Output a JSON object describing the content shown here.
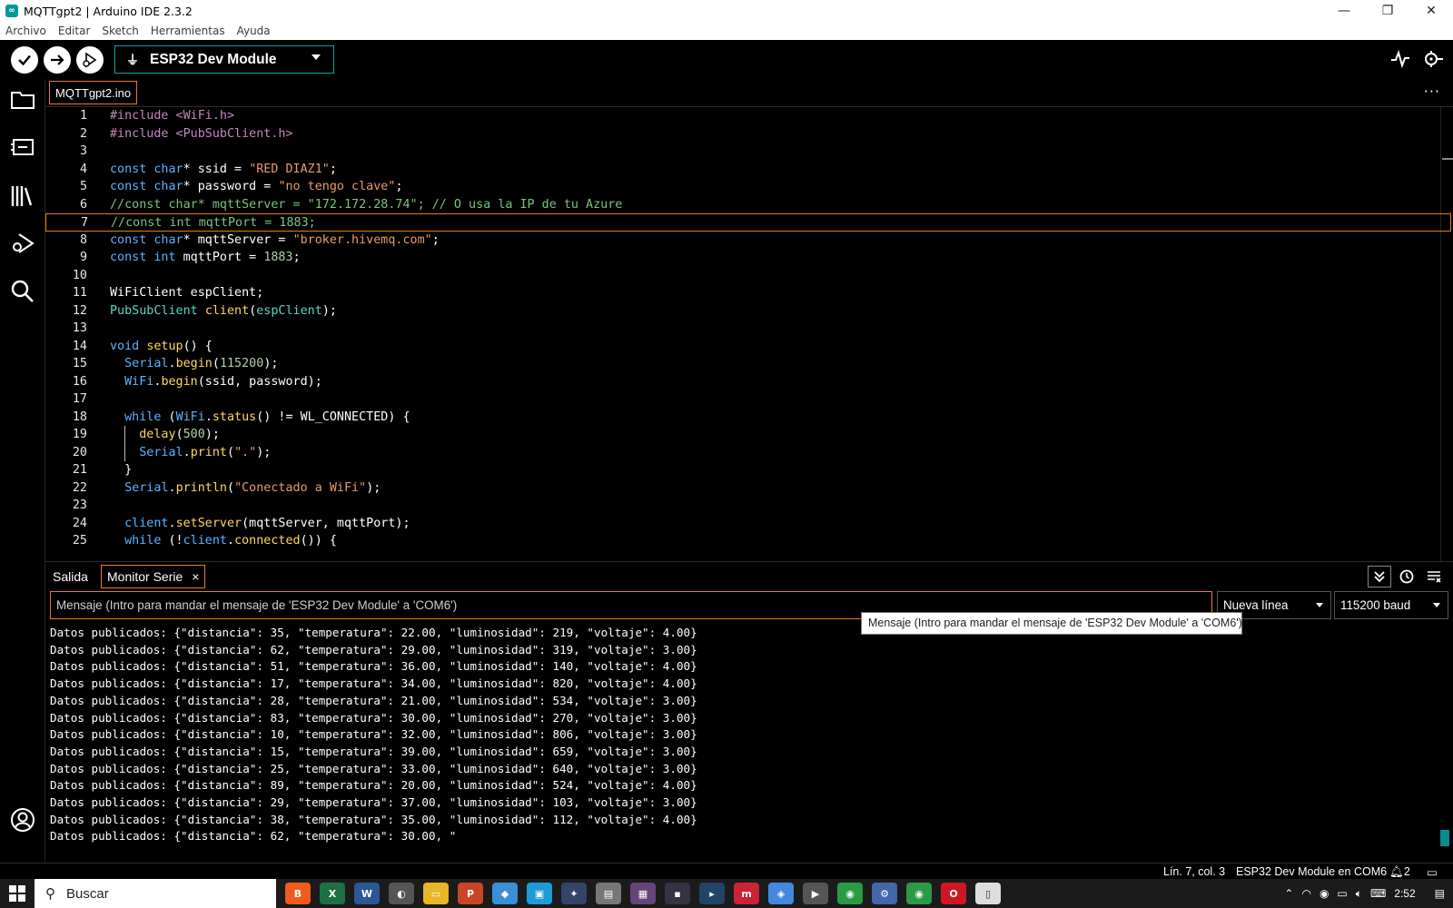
{
  "window": {
    "title": "MQTTgpt2 | Arduino IDE 2.3.2",
    "minimize": "—",
    "restore": "❐",
    "close": "✕"
  },
  "menu": [
    "Archivo",
    "Editar",
    "Sketch",
    "Herramientas",
    "Ayuda"
  ],
  "toolbar": {
    "board": "ESP32 Dev Module"
  },
  "editor": {
    "file_tab": "MQTTgpt2.ino",
    "more": "···",
    "current_line": 7,
    "lines": [
      {
        "n": "1",
        "html": "<span class=\"pp\">#include &lt;WiFi.h&gt;</span>"
      },
      {
        "n": "2",
        "html": "<span class=\"pp\">#include &lt;PubSubClient.h&gt;</span>"
      },
      {
        "n": "3",
        "html": ""
      },
      {
        "n": "4",
        "html": "<span class=\"kw\">const</span> <span class=\"ty\">char</span>* ssid = <span class=\"str\">\"RED DIAZ1\"</span>;"
      },
      {
        "n": "5",
        "html": "<span class=\"kw\">const</span> <span class=\"ty\">char</span>* password = <span class=\"str\">\"no tengo clave\"</span>;"
      },
      {
        "n": "6",
        "html": "<span class=\"cm\">//const char* mqttServer = \"172.172.28.74\"; // O usa la IP de tu Azure</span>"
      },
      {
        "n": "7",
        "html": "<span class=\"cm\">//const int mqttPort = 1883;</span>"
      },
      {
        "n": "8",
        "html": "<span class=\"kw\">const</span> <span class=\"ty\">char</span>* mqttServer = <span class=\"str\">\"broker.hivemq.com\"</span>;"
      },
      {
        "n": "9",
        "html": "<span class=\"kw\">const</span> <span class=\"ty\">int</span> mqttPort = <span class=\"num\">1883</span>;"
      },
      {
        "n": "10",
        "html": ""
      },
      {
        "n": "11",
        "html": "WiFiClient espClient;"
      },
      {
        "n": "12",
        "html": "<span class=\"cls\">PubSubClient</span> <span class=\"fn\">client</span>(<span class=\"cls\">espClient</span>);"
      },
      {
        "n": "13",
        "html": ""
      },
      {
        "n": "14",
        "html": "<span class=\"kw\">void</span> <span class=\"fn\">setup</span>() {"
      },
      {
        "n": "15",
        "html": "  <span class=\"obj\">Serial</span>.<span class=\"fn\">begin</span>(<span class=\"num\">115200</span>);"
      },
      {
        "n": "16",
        "html": "  <span class=\"obj\">WiFi</span>.<span class=\"fn\">begin</span>(ssid, password);"
      },
      {
        "n": "17",
        "html": ""
      },
      {
        "n": "18",
        "html": "  <span class=\"kw\">while</span> (<span class=\"obj\">WiFi</span>.<span class=\"fn\">status</span>() != WL_CONNECTED) {"
      },
      {
        "n": "19",
        "html": "    <span class=\"fn\">delay</span>(<span class=\"num\">500</span>);"
      },
      {
        "n": "20",
        "html": "    <span class=\"obj\">Serial</span>.<span class=\"fn\">print</span>(<span class=\"str\">\".\"</span>);"
      },
      {
        "n": "21",
        "html": "  }"
      },
      {
        "n": "22",
        "html": "  <span class=\"obj\">Serial</span>.<span class=\"fn\">println</span>(<span class=\"str\">\"Conectado a WiFi\"</span>);"
      },
      {
        "n": "23",
        "html": ""
      },
      {
        "n": "24",
        "html": "  <span class=\"obj\">client</span>.<span class=\"fn\">setServer</span>(mqttServer, mqttPort);"
      },
      {
        "n": "25",
        "html": "  <span class=\"kw\">while</span> (!<span class=\"obj\">client</span>.<span class=\"fn\">connected</span>()) {"
      }
    ]
  },
  "panel": {
    "tab_output": "Salida",
    "tab_monitor": "Monitor Serie",
    "close": "×",
    "message_placeholder": "Mensaje (Intro para mandar el mensaje de 'ESP32 Dev Module' a 'COM6')",
    "line_ending": "Nueva línea",
    "baud": "115200 baud",
    "tooltip": "Mensaje (Intro para mandar el mensaje de 'ESP32 Dev Module' a 'COM6')",
    "serial_lines": [
      "Datos publicados: {\"distancia\": 35, \"temperatura\": 22.00, \"luminosidad\": 219, \"voltaje\": 4.00}",
      "Datos publicados: {\"distancia\": 62, \"temperatura\": 29.00, \"luminosidad\": 319, \"voltaje\": 3.00}",
      "Datos publicados: {\"distancia\": 51, \"temperatura\": 36.00, \"luminosidad\": 140, \"voltaje\": 4.00}",
      "Datos publicados: {\"distancia\": 17, \"temperatura\": 34.00, \"luminosidad\": 820, \"voltaje\": 4.00}",
      "Datos publicados: {\"distancia\": 28, \"temperatura\": 21.00, \"luminosidad\": 534, \"voltaje\": 3.00}",
      "Datos publicados: {\"distancia\": 83, \"temperatura\": 30.00, \"luminosidad\": 270, \"voltaje\": 3.00}",
      "Datos publicados: {\"distancia\": 10, \"temperatura\": 32.00, \"luminosidad\": 806, \"voltaje\": 3.00}",
      "Datos publicados: {\"distancia\": 15, \"temperatura\": 39.00, \"luminosidad\": 659, \"voltaje\": 3.00}",
      "Datos publicados: {\"distancia\": 25, \"temperatura\": 33.00, \"luminosidad\": 640, \"voltaje\": 3.00}",
      "Datos publicados: {\"distancia\": 89, \"temperatura\": 20.00, \"luminosidad\": 524, \"voltaje\": 4.00}",
      "Datos publicados: {\"distancia\": 29, \"temperatura\": 37.00, \"luminosidad\": 103, \"voltaje\": 3.00}",
      "Datos publicados: {\"distancia\": 38, \"temperatura\": 35.00, \"luminosidad\": 112, \"voltaje\": 4.00}",
      "Datos publicados: {\"distancia\": 62, \"temperatura\": 30.00, \""
    ]
  },
  "status": {
    "position": "Lín. 7, col. 3",
    "board_port": "ESP32 Dev Module en COM6",
    "notifications": "2"
  },
  "taskbar": {
    "search": "Buscar",
    "time": "2:52",
    "apps": [
      {
        "icon": "brave-icon",
        "color": "#f25b1e",
        "label": "B"
      },
      {
        "icon": "excel-icon",
        "color": "#1d7044",
        "label": "X"
      },
      {
        "icon": "word-icon",
        "color": "#2b5797",
        "label": "W"
      },
      {
        "icon": "app-icon",
        "color": "#555555",
        "label": "◐"
      },
      {
        "icon": "file-explorer-icon",
        "color": "#e8b628",
        "label": "▭"
      },
      {
        "icon": "powerpoint-icon",
        "color": "#c84625",
        "label": "P"
      },
      {
        "icon": "app-icon",
        "color": "#3a8fd6",
        "label": "◆"
      },
      {
        "icon": "app-icon",
        "color": "#1e9ad6",
        "label": "▣"
      },
      {
        "icon": "app-icon",
        "color": "#334466",
        "label": "✦"
      },
      {
        "icon": "app-icon",
        "color": "#777777",
        "label": "▤"
      },
      {
        "icon": "app-icon",
        "color": "#664477",
        "label": "▦"
      },
      {
        "icon": "app-icon",
        "color": "#333344",
        "label": "▪"
      },
      {
        "icon": "app-icon",
        "color": "#224466",
        "label": "▸"
      },
      {
        "icon": "app-icon",
        "color": "#cc2233",
        "label": "m"
      },
      {
        "icon": "app-icon",
        "color": "#4488dd",
        "label": "◈"
      },
      {
        "icon": "app-icon",
        "color": "#555555",
        "label": "▶"
      },
      {
        "icon": "chrome-icon",
        "color": "#2a9a45",
        "label": "◉"
      },
      {
        "icon": "app-icon",
        "color": "#4466aa",
        "label": "⚙"
      },
      {
        "icon": "chrome-icon",
        "color": "#2a9a45",
        "label": "◉"
      },
      {
        "icon": "opera-icon",
        "color": "#d01623",
        "label": "O"
      },
      {
        "icon": "app-icon",
        "color": "#dddddd",
        "label": "▯"
      }
    ]
  }
}
